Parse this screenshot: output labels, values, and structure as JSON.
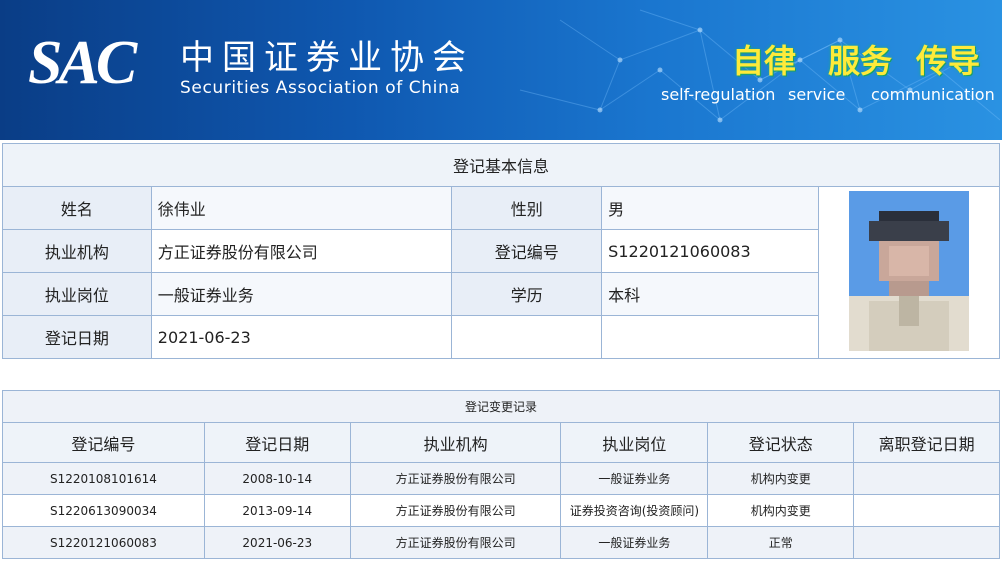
{
  "header": {
    "logo_abbr": "SAC",
    "org_name_cn": "中国证券业协会",
    "org_name_en": "Securities Association of China",
    "slogans": [
      {
        "cn": "自律",
        "en": "self-regulation"
      },
      {
        "cn": "服务",
        "en": "service"
      },
      {
        "cn": "传导",
        "en": "communication"
      }
    ],
    "accent_color": "#ffea3a"
  },
  "basic_info": {
    "title": "登记基本信息",
    "name_label": "姓名",
    "name_value": "徐伟业",
    "gender_label": "性别",
    "gender_value": "男",
    "org_label": "执业机构",
    "org_value": "方正证券股份有限公司",
    "reg_no_label": "登记编号",
    "reg_no_value": "S1220121060083",
    "position_label": "执业岗位",
    "position_value": "一般证券业务",
    "edu_label": "学历",
    "edu_value": "本科",
    "date_label": "登记日期",
    "date_value": "2021-06-23"
  },
  "change_records": {
    "title": "登记变更记录",
    "columns": [
      "登记编号",
      "登记日期",
      "执业机构",
      "执业岗位",
      "登记状态",
      "离职登记日期"
    ],
    "rows": [
      [
        "S1220108101614",
        "2008-10-14",
        "方正证券股份有限公司",
        "一般证券业务",
        "机构内变更",
        ""
      ],
      [
        "S1220613090034",
        "2013-09-14",
        "方正证券股份有限公司",
        "证券投资咨询(投资顾问)",
        "机构内变更",
        ""
      ],
      [
        "S1220121060083",
        "2021-06-23",
        "方正证券股份有限公司",
        "一般证券业务",
        "正常",
        ""
      ]
    ]
  }
}
